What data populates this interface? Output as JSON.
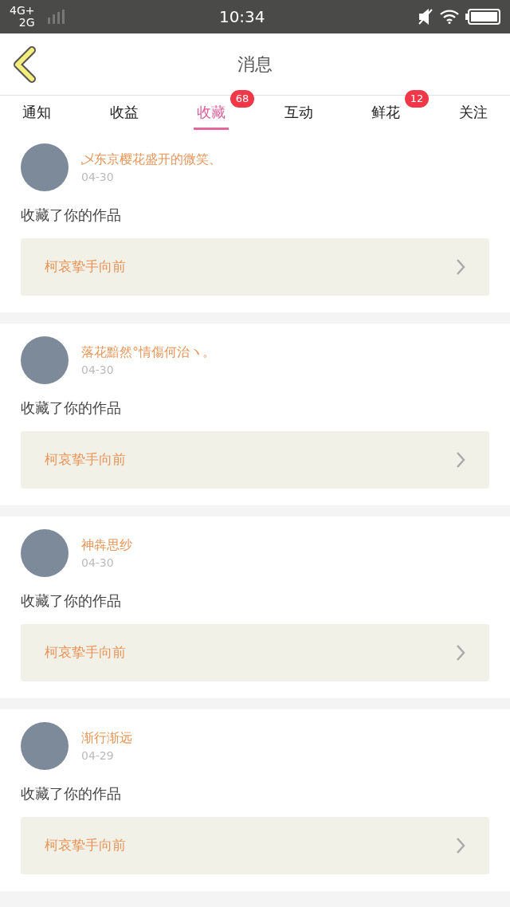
{
  "status_bar": {
    "network_1": "4G+",
    "network_2": "2G",
    "time": "10:34"
  },
  "header": {
    "title": "消息"
  },
  "tabs": [
    {
      "label": "通知",
      "selected": false
    },
    {
      "label": "收益",
      "selected": false
    },
    {
      "label": "收藏",
      "selected": true,
      "badge": "68"
    },
    {
      "label": "互动",
      "selected": false
    },
    {
      "label": "鲜花",
      "selected": false,
      "badge": "12"
    },
    {
      "label": "关注",
      "selected": false
    }
  ],
  "messages": [
    {
      "user": "乄东京樱花盛开的微笑、",
      "date": "04-30",
      "text": "收藏了你的作品",
      "work": "柯哀挚手向前"
    },
    {
      "user": "落花黯然°情傷何治ヽ。",
      "date": "04-30",
      "text": "收藏了你的作品",
      "work": "柯哀挚手向前"
    },
    {
      "user": "神犇思纱",
      "date": "04-30",
      "text": "收藏了你的作品",
      "work": "柯哀挚手向前"
    },
    {
      "user": "渐行渐远",
      "date": "04-29",
      "text": "收藏了你的作品",
      "work": "柯哀挚手向前"
    }
  ]
}
